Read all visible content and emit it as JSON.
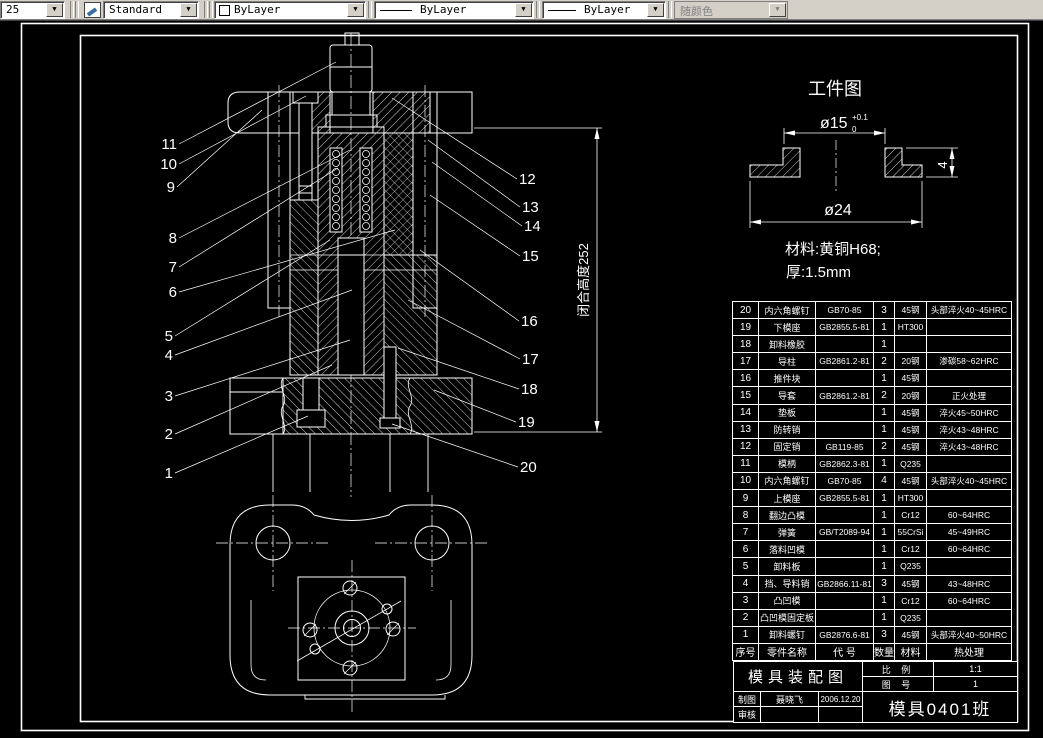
{
  "toolbar": {
    "left_combo_value": "25",
    "style_combo_value": "Standard",
    "color_combo_value": "ByLayer",
    "linetype_combo_value": "ByLayer",
    "lineweight_combo_value": "ByLayer",
    "plotstyle_combo_value": "随颜色",
    "dropdown_arrow": "▼"
  },
  "workpiece": {
    "title": "工件图",
    "dim_top": "ø15",
    "dim_top_tol_upper": "+0.1",
    "dim_top_tol_lower": "0",
    "dim_bottom": "ø24",
    "dim_height": "4",
    "note_material": "材料:黄铜H68;",
    "note_thickness": "厚:1.5mm"
  },
  "assembly": {
    "dim_closed_height": "闭合高度252",
    "balloons_left": [
      "11",
      "10",
      "9",
      "8",
      "7",
      "6",
      "5",
      "4",
      "3",
      "2",
      "1"
    ],
    "balloons_right": [
      "12",
      "13",
      "14",
      "15",
      "16",
      "17",
      "18",
      "19",
      "20"
    ]
  },
  "bom": {
    "headers": [
      "序号",
      "零件名称",
      "代 号",
      "数量",
      "材料",
      "热处理"
    ],
    "rows": [
      [
        "20",
        "内六角螺钉",
        "GB70-85",
        "3",
        "45钢",
        "头部淬火40~45HRC"
      ],
      [
        "19",
        "下模座",
        "GB2855.5-81",
        "1",
        "HT300",
        ""
      ],
      [
        "18",
        "卸料橡胶",
        "",
        "1",
        "",
        ""
      ],
      [
        "17",
        "导柱",
        "GB2861.2-81",
        "2",
        "20钢",
        "渗碳58~62HRC"
      ],
      [
        "16",
        "推件块",
        "",
        "1",
        "45钢",
        ""
      ],
      [
        "15",
        "导套",
        "GB2861.2-81",
        "2",
        "20钢",
        "正火处理"
      ],
      [
        "14",
        "垫板",
        "",
        "1",
        "45钢",
        "淬火45~50HRC"
      ],
      [
        "13",
        "防转销",
        "",
        "1",
        "45钢",
        "淬火43~48HRC"
      ],
      [
        "12",
        "固定销",
        "GB119-85",
        "2",
        "45钢",
        "淬火43~48HRC"
      ],
      [
        "11",
        "模柄",
        "GB2862.3-81",
        "1",
        "Q235",
        ""
      ],
      [
        "10",
        "内六角螺钉",
        "GB70-85",
        "4",
        "45钢",
        "头部淬火40~45HRC"
      ],
      [
        "9",
        "上模座",
        "GB2855.5-81",
        "1",
        "HT300",
        ""
      ],
      [
        "8",
        "翻边凸模",
        "",
        "1",
        "Cr12",
        "60~64HRC"
      ],
      [
        "7",
        "弹簧",
        "GB/T2089-94",
        "1",
        "55CrSi",
        "45~49HRC"
      ],
      [
        "6",
        "落料凹模",
        "",
        "1",
        "Cr12",
        "60~64HRC"
      ],
      [
        "5",
        "卸料板",
        "",
        "1",
        "Q235",
        ""
      ],
      [
        "4",
        "挡、导料销",
        "GB2866.11-81",
        "3",
        "45钢",
        "43~48HRC"
      ],
      [
        "3",
        "凸凹模",
        "",
        "1",
        "Cr12",
        "60~64HRC"
      ],
      [
        "2",
        "凸凹模固定板",
        "",
        "1",
        "Q235",
        ""
      ],
      [
        "1",
        "卸料螺钉",
        "GB2876.6-81",
        "3",
        "45钢",
        "头部淬火40~50HRC"
      ]
    ]
  },
  "titleblock": {
    "drawing_name": "模具装配图",
    "scale_label": "比 例",
    "scale_value": "1:1",
    "number_label": "图 号",
    "number_value": "1",
    "drafter_label": "制图",
    "drafter_name": "聂晓飞",
    "date": "2006.12.20",
    "checker_label": "审核",
    "class_name": "模具0401班"
  },
  "colors": {
    "canvas_bg": "#000000",
    "line": "#ffffff",
    "toolbar_bg": "#d4d0c8",
    "disabled_text": "#808080"
  }
}
